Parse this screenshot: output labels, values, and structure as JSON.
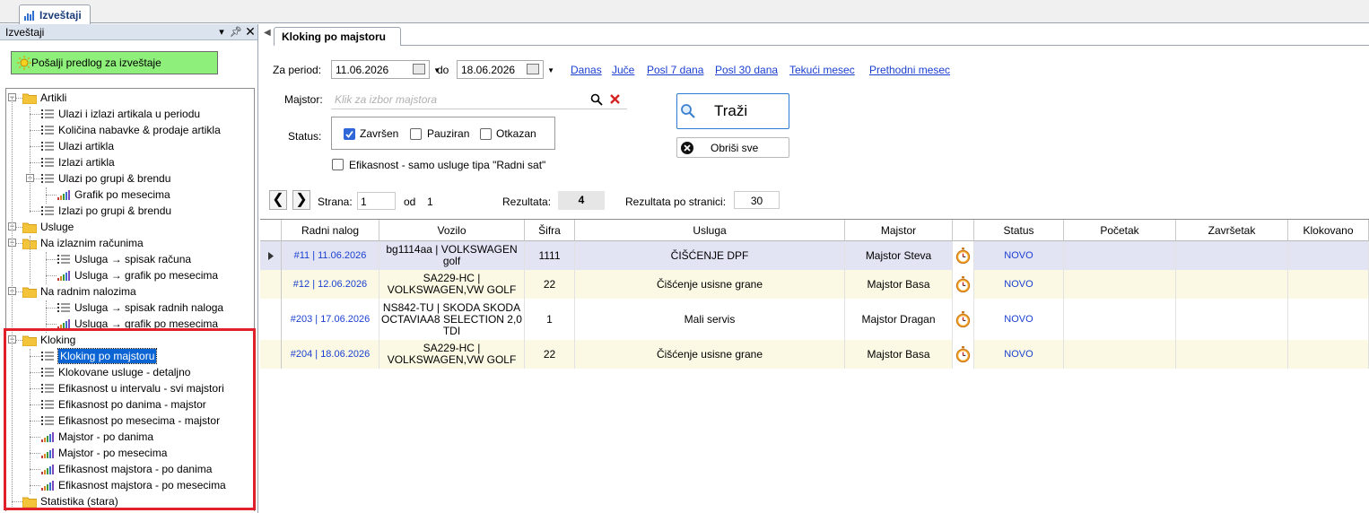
{
  "doc_tab": {
    "title": "Izveštaji"
  },
  "left_panel": {
    "title": "Izveštaji",
    "pin_icon": "pin-icon",
    "close_icon": "close-icon",
    "send_button": "Pošalji predlog za izveštaje",
    "tree": {
      "artikli": "Artikli",
      "ulazi_izlazi_period": "Ulazi i izlazi artikala u periodu",
      "kolicina_nabavke": "Količina nabavke & prodaje artikla",
      "ulazi_artikla": "Ulazi artikla",
      "izlazi_artikla": "Izlazi artikla",
      "ulazi_grupi": "Ulazi po grupi & brendu",
      "grafik_mesecima": "Grafik po mesecima",
      "izlazi_grupi": "Izlazi po grupi & brendu",
      "usluge": "Usluge",
      "na_izlaznim": "Na izlaznim računima",
      "usluge_spisak_racuna": "Usluga → spisak računa",
      "usluge_grafik_1": "Usluga → grafik po mesecima",
      "na_radnim": "Na radnim nalozima",
      "usluge_spisak_naloga": "Usluga → spisak radnih naloga",
      "usluge_grafik_2": "Usluga → grafik po mesecima",
      "kloking": "Kloking",
      "kloking_po_majstoru": "Kloking po majstoru",
      "klokovane_detaljno": "Klokovane usluge - detaljno",
      "efikasnost_intervalu": "Efikasnost u intervalu - svi majstori",
      "efikasnost_danima": "Efikasnost po danima - majstor",
      "efikasnost_mesecima": "Efikasnost po mesecima - majstor",
      "majstor_danima": "Majstor - po danima",
      "majstor_mesecima": "Majstor - po mesecima",
      "efik_majstora_danima": "Efikasnost majstora - po danima",
      "efik_majstora_mesecima": "Efikasnost majstora - po mesecima",
      "statistika": "Statistika (stara)"
    }
  },
  "report": {
    "tab_title": "Kloking po majstoru",
    "period_label": "Za period:",
    "date_from": "11.06.2026",
    "to_label": "do",
    "date_to": "18.06.2026",
    "quick_links": [
      "Danas",
      "Juče",
      "Posl 7 dana",
      "Posl 30 dana",
      "Tekući mesec",
      "Prethodni mesec"
    ],
    "majstor_label": "Majstor:",
    "majstor_placeholder": "Klik za izbor majstora",
    "status_label": "Status:",
    "status_options": [
      {
        "label": "Završen",
        "checked": true
      },
      {
        "label": "Pauziran",
        "checked": false
      },
      {
        "label": "Otkazan",
        "checked": false
      }
    ],
    "efikasnost_label": "Efikasnost - samo usluge tipa \"Radni sat\"",
    "efikasnost_checked": false,
    "search_button": "Traži",
    "clear_button": "Obriši sve",
    "page_label": "Strana:",
    "page_value": "1",
    "of_label": "od",
    "page_total": "1",
    "results_label": "Rezultata:",
    "results_count": "4",
    "per_page_label": "Rezultata po stranici:",
    "per_page_value": "30"
  },
  "grid": {
    "columns": [
      "Radni nalog",
      "Vozilo",
      "Šifra",
      "Usluga",
      "Majstor",
      "",
      "Status",
      "Početak",
      "Završetak",
      "Klokovano"
    ],
    "rows": [
      {
        "nalog": "#11  |  11.06.2026",
        "vozilo": "bg1114aa | VOLKSWAGEN golf",
        "sifra": "1111",
        "usluga": "ČIŠĆENJE DPF",
        "majstor": "Majstor Steva",
        "status": "NOVO",
        "pocetak": "",
        "zavrsetak": "",
        "klokovano": ""
      },
      {
        "nalog": "#12  |  12.06.2026",
        "vozilo": "SA229-HC | VOLKSWAGEN,VW GOLF",
        "sifra": "22",
        "usluga": "Čišćenje usisne grane",
        "majstor": "Majstor Basa",
        "status": "NOVO",
        "pocetak": "",
        "zavrsetak": "",
        "klokovano": ""
      },
      {
        "nalog": "#203  |  17.06.2026",
        "vozilo": "NS842-TU | SKODA SKODA OCTAVIAA8 SELECTION 2,0 TDI",
        "sifra": "1",
        "usluga": "Mali servis",
        "majstor": "Majstor Dragan",
        "status": "NOVO",
        "pocetak": "",
        "zavrsetak": "",
        "klokovano": ""
      },
      {
        "nalog": "#204  |  18.06.2026",
        "vozilo": "SA229-HC | VOLKSWAGEN,VW GOLF",
        "sifra": "22",
        "usluga": "Čišćenje usisne grane",
        "majstor": "Majstor Basa",
        "status": "NOVO",
        "pocetak": "",
        "zavrsetak": "",
        "klokovano": ""
      }
    ]
  },
  "colors": {
    "selected_row": "#e2e4f4",
    "alt_row": "#fbf9e3",
    "link": "#1a3fd0",
    "green_button": "#8ef07a",
    "highlight_border": "#e0202a"
  }
}
